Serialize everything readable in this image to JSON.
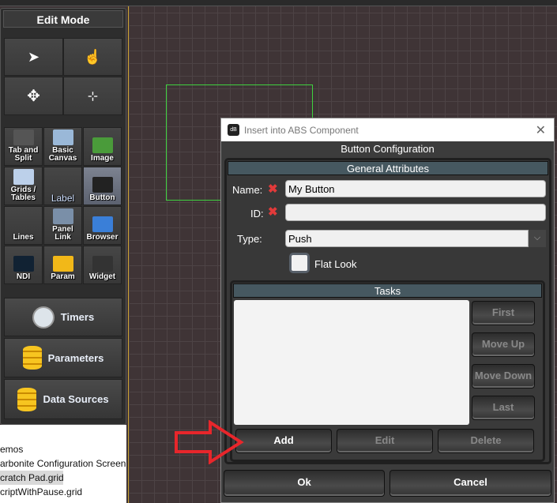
{
  "left_panel": {
    "header": "Edit Mode",
    "tools": [
      "select-arrow",
      "pointer-hand",
      "move",
      "resize"
    ],
    "widgets": [
      {
        "label": "Tab and Split",
        "icon": "tab-split-icon"
      },
      {
        "label": "Basic Canvas",
        "icon": "canvas-icon"
      },
      {
        "label": "Image",
        "icon": "image-icon"
      },
      {
        "label": "Grids / Tables",
        "icon": "grid-icon"
      },
      {
        "label": "Label",
        "icon": "label-icon"
      },
      {
        "label": "Button",
        "icon": "button-icon",
        "selected": true
      },
      {
        "label": "Lines",
        "icon": "lines-icon"
      },
      {
        "label": "Panel Link",
        "icon": "panel-link-icon"
      },
      {
        "label": "Browser",
        "icon": "globe-icon"
      },
      {
        "label": "NDI",
        "icon": "ndi-icon"
      },
      {
        "label": "Param",
        "icon": "database-icon"
      },
      {
        "label": "Widget",
        "icon": "widget-icon"
      }
    ],
    "timers": "Timers",
    "parameters": "Parameters",
    "data_sources": "Data Sources"
  },
  "files": [
    "emos",
    "arbonite Configuration Screen",
    "cratch Pad.grid",
    "criptWithPause.grid"
  ],
  "dialog": {
    "title": "Insert into ABS Component",
    "subtitle": "Button Configuration",
    "general_header": "General Attributes",
    "name_label": "Name:",
    "name_value": "My Button",
    "id_label": "ID:",
    "id_value": "",
    "type_label": "Type:",
    "type_value": "Push",
    "flat_look_label": "Flat Look",
    "flat_look_checked": false,
    "tasks_header": "Tasks",
    "side_buttons": [
      "First",
      "Move Up",
      "Move Down",
      "Last"
    ],
    "add": "Add",
    "edit": "Edit",
    "delete": "Delete",
    "ok": "Ok",
    "cancel": "Cancel"
  },
  "colors": {
    "accent_arrow": "#e8262b",
    "selection_box": "#3fd13f",
    "group_header": "#465860"
  }
}
